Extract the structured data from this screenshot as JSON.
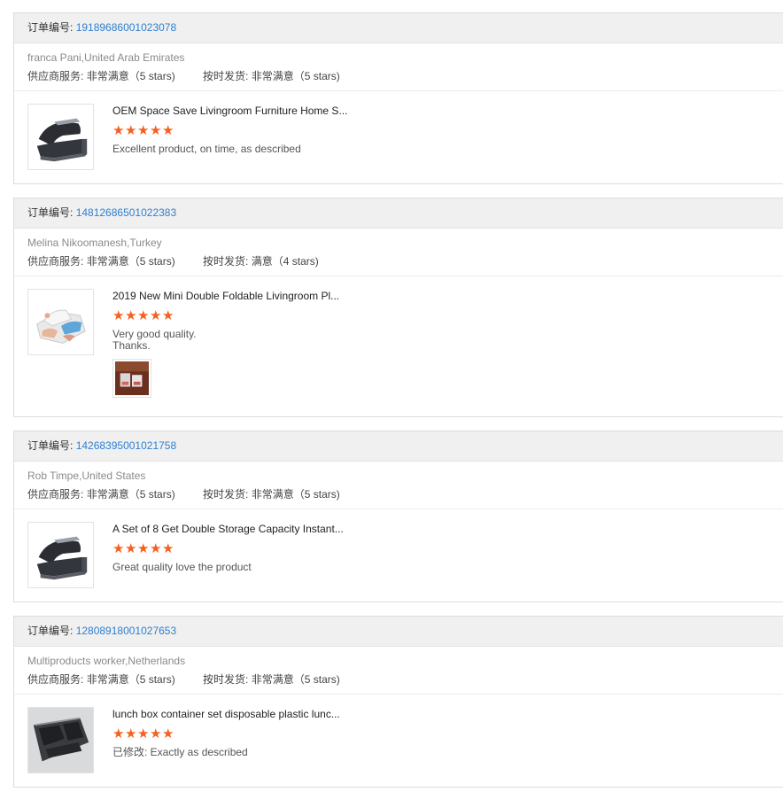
{
  "order_label": "订单编号:",
  "supplier_label": "供应商服务:",
  "ship_label": "按时发货:",
  "star_glyph": "★",
  "star_color": "#f5601f",
  "link_color": "#2d7fd1",
  "reviews": [
    {
      "order_no": "19189686001023078",
      "buyer": "franca Pani,United Arab Emirates",
      "supplier_rating": "非常满意（5 stars)",
      "ship_rating": "非常满意（5 stars)",
      "product_title": "OEM Space Save Livingroom Furniture Home S...",
      "stars": 5,
      "feedback": "Excellent product, on time, as described",
      "thumb_icon": "shoe-rack-dark-icon"
    },
    {
      "order_no": "14812686501022383",
      "buyer": "Melina Nikoomanesh,Turkey",
      "supplier_rating": "非常满意（5 stars)",
      "ship_rating": "满意（4 stars)",
      "product_title": "2019 New Mini Double Foldable Livingroom Pl...",
      "stars": 5,
      "feedback": "Very good quality.\nThanks.",
      "thumb_icon": "shoe-rack-white-icon",
      "has_photo": true
    },
    {
      "order_no": "14268395001021758",
      "buyer": "Rob Timpe,United States",
      "supplier_rating": "非常满意（5 stars)",
      "ship_rating": "非常满意（5 stars)",
      "product_title": "A Set of 8 Get Double Storage Capacity Instant...",
      "stars": 5,
      "feedback": "Great quality love the product",
      "thumb_icon": "shoe-rack-dark-icon"
    },
    {
      "order_no": "12808918001027653",
      "buyer": "Multiproducts worker,Netherlands",
      "supplier_rating": "非常满意（5 stars)",
      "ship_rating": "非常满意（5 stars)",
      "product_title": "lunch box container set disposable plastic lunc...",
      "stars": 5,
      "feedback": "已修改: Exactly as described",
      "thumb_icon": "lunch-box-icon"
    }
  ]
}
